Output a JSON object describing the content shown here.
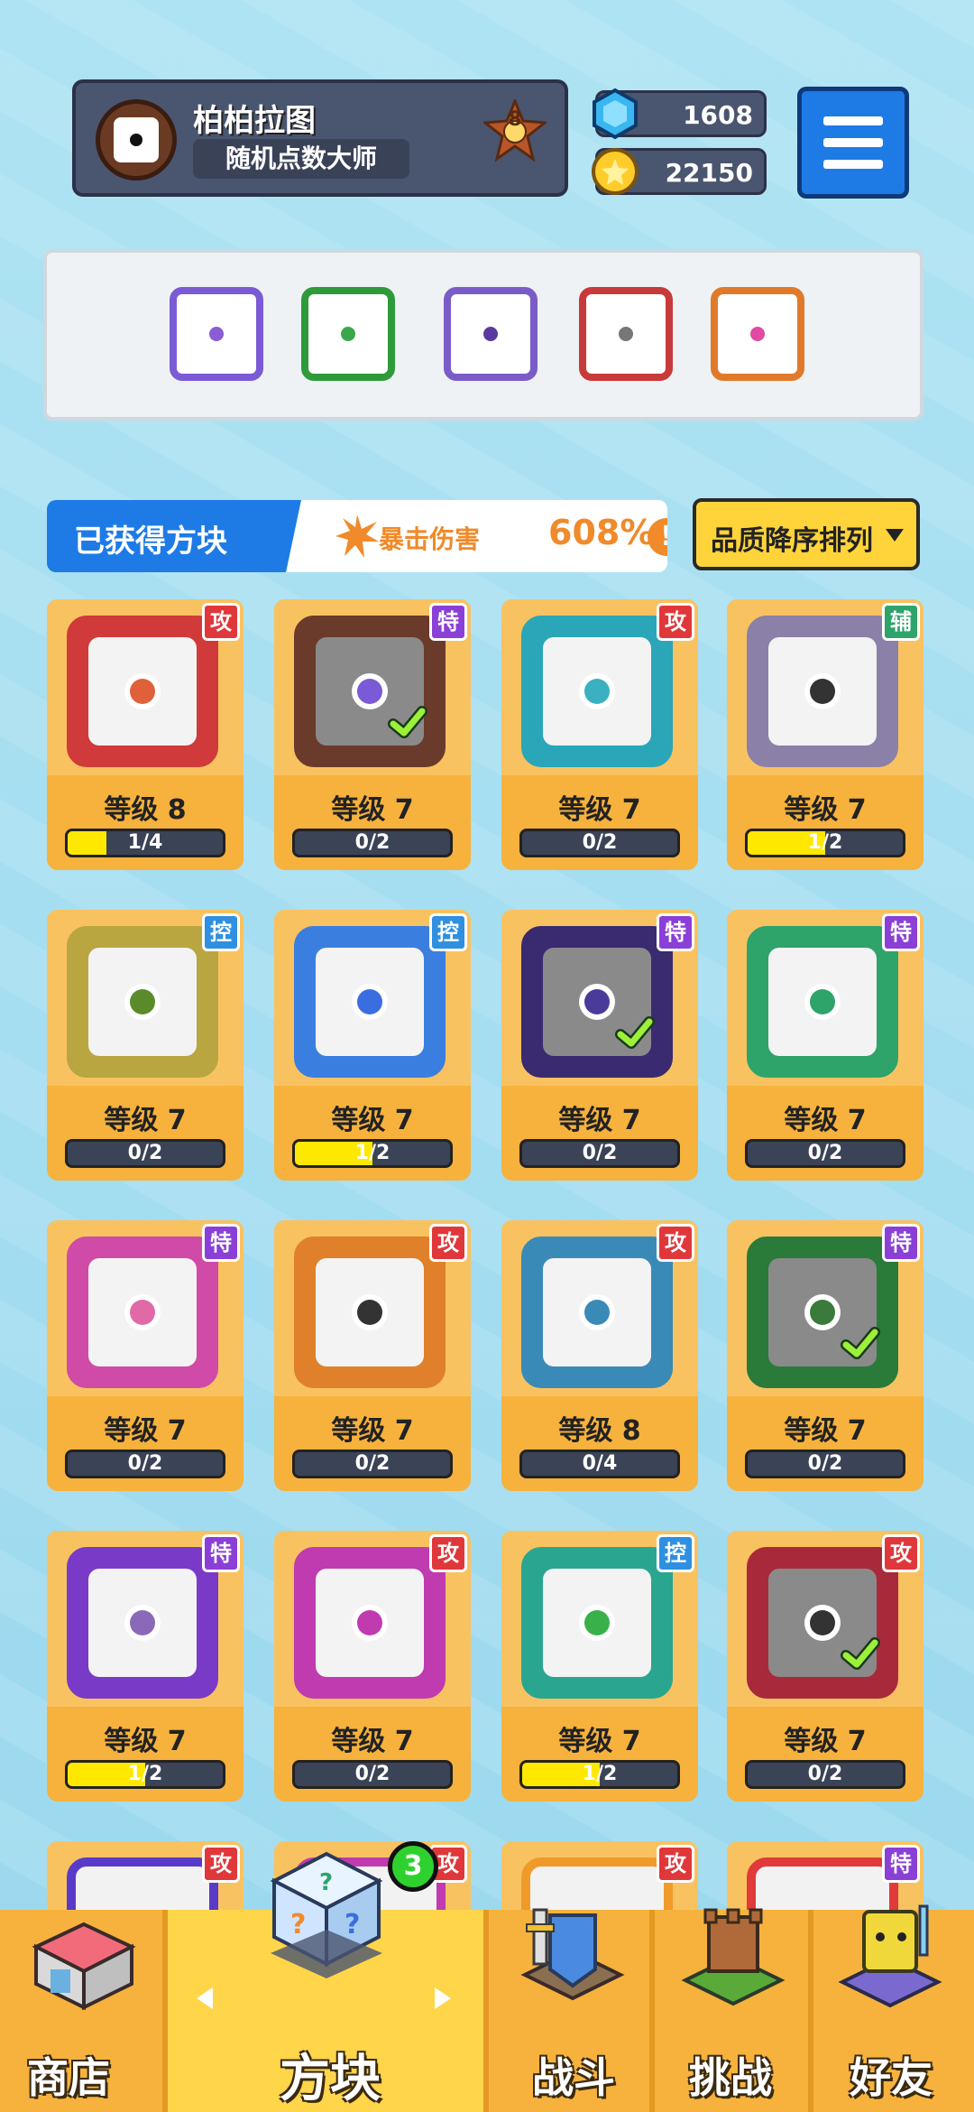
{
  "profile": {
    "name": "柏柏拉图",
    "title": "随机点数大师",
    "rank": "8"
  },
  "currency": {
    "gems": "1608",
    "coins": "22150"
  },
  "equipped": [
    {
      "name": "purple-dragon-dice",
      "color": "#7b5ad6",
      "dot": "#8a5cd6"
    },
    {
      "name": "green-dragon-dice",
      "color": "#2e9a3a",
      "dot": "#3aa84a"
    },
    {
      "name": "crack-dice",
      "color": "#7a5cc9",
      "dot": "#5a3aa0"
    },
    {
      "name": "blade-dragon-dice",
      "color": "#c83a3a",
      "dot": "#777777"
    },
    {
      "name": "combo-dragon-dice",
      "color": "#e07a2a",
      "dot": "#e04aa0"
    }
  ],
  "section": {
    "obtained_label": "已获得方块",
    "crit_label": "暴击伤害",
    "crit_value": "608%",
    "crit_info": "!",
    "sort_label": "品质降序排列"
  },
  "type_colors": {
    "攻": "#e0373a",
    "特": "#8a3fd6",
    "控": "#2f8fe0",
    "辅": "#2ea36a"
  },
  "cards": [
    {
      "type": "攻",
      "level": "等级 8",
      "progress": "1/4",
      "fill": 0.25,
      "frame": "#d03a3a",
      "dot": "#e0603a",
      "owned": false
    },
    {
      "type": "特",
      "level": "等级 7",
      "progress": "0/2",
      "fill": 0,
      "frame": "#6a3a2a",
      "dot": "#7a5ad6",
      "owned": true
    },
    {
      "type": "攻",
      "level": "等级 7",
      "progress": "0/2",
      "fill": 0,
      "frame": "#2aa6b8",
      "dot": "#3ab0c0",
      "owned": false
    },
    {
      "type": "辅",
      "level": "等级 7",
      "progress": "1/2",
      "fill": 0.5,
      "frame": "#8a80a8",
      "dot": "#333333",
      "owned": false
    },
    {
      "type": "控",
      "level": "等级 7",
      "progress": "0/2",
      "fill": 0,
      "frame": "#b9a640",
      "dot": "#5a8a2a",
      "owned": false
    },
    {
      "type": "控",
      "level": "等级 7",
      "progress": "1/2",
      "fill": 0.5,
      "frame": "#3a7ee0",
      "dot": "#3a6ee0",
      "owned": false
    },
    {
      "type": "特",
      "level": "等级 7",
      "progress": "0/2",
      "fill": 0,
      "frame": "#3a2a70",
      "dot": "#4a3a9a",
      "owned": true
    },
    {
      "type": "特",
      "level": "等级 7",
      "progress": "0/2",
      "fill": 0,
      "frame": "#2ea36a",
      "dot": "#2ea36a",
      "owned": false
    },
    {
      "type": "特",
      "level": "等级 7",
      "progress": "0/2",
      "fill": 0,
      "frame": "#d04aa8",
      "dot": "#e06aa8",
      "owned": false
    },
    {
      "type": "攻",
      "level": "等级 7",
      "progress": "0/2",
      "fill": 0,
      "frame": "#e0802a",
      "dot": "#333333",
      "owned": false
    },
    {
      "type": "攻",
      "level": "等级 8",
      "progress": "0/4",
      "fill": 0,
      "frame": "#3a8ab8",
      "dot": "#3a8ab8",
      "owned": false
    },
    {
      "type": "特",
      "level": "等级 7",
      "progress": "0/2",
      "fill": 0,
      "frame": "#2a7a3a",
      "dot": "#3a7a3a",
      "owned": true
    },
    {
      "type": "特",
      "level": "等级 7",
      "progress": "1/2",
      "fill": 0.5,
      "frame": "#7a3ac8",
      "dot": "#8a6ab8",
      "owned": false
    },
    {
      "type": "攻",
      "level": "等级 7",
      "progress": "0/2",
      "fill": 0,
      "frame": "#c03ab0",
      "dot": "#c03ab0",
      "owned": false
    },
    {
      "type": "控",
      "level": "等级 7",
      "progress": "1/2",
      "fill": 0.5,
      "frame": "#2aa690",
      "dot": "#3ab04a",
      "owned": false
    },
    {
      "type": "攻",
      "level": "等级 7",
      "progress": "0/2",
      "fill": 0,
      "frame": "#a82a3a",
      "dot": "#333333",
      "owned": true
    }
  ],
  "peek_row": [
    {
      "type": "攻",
      "frame": "#5a3ac8"
    },
    {
      "type": "攻",
      "frame": "#c03ab0"
    },
    {
      "type": "攻",
      "frame": "#f09a2a"
    },
    {
      "type": "特",
      "frame": "#e03a3a"
    }
  ],
  "nav": {
    "shop": "商店",
    "dice": "方块",
    "battle": "战斗",
    "challenge": "挑战",
    "friends": "好友",
    "dice_badge": "3"
  }
}
